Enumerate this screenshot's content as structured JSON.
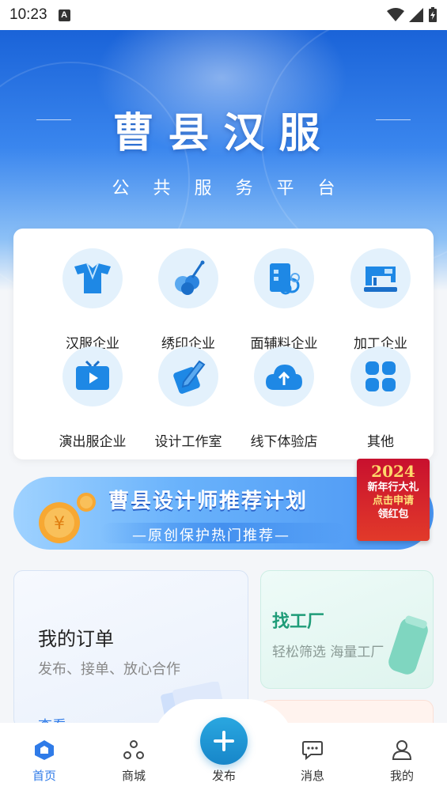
{
  "status_bar": {
    "time": "10:23",
    "indicator": "A"
  },
  "hero": {
    "title": "曹县汉服",
    "subtitle": "公共服务平台"
  },
  "categories": [
    {
      "label": "汉服企业",
      "icon": "hanfu-robe-icon"
    },
    {
      "label": "绣印企业",
      "icon": "embroidery-icon"
    },
    {
      "label": "面辅料企业",
      "icon": "fabric-icon"
    },
    {
      "label": "加工企业",
      "icon": "sewing-machine-icon"
    },
    {
      "label": "演出服企业",
      "icon": "tv-play-icon"
    },
    {
      "label": "设计工作室",
      "icon": "design-pen-icon"
    },
    {
      "label": "线下体验店",
      "icon": "cloud-upload-icon"
    },
    {
      "label": "其他",
      "icon": "grid-icon"
    }
  ],
  "banner": {
    "title": "曹县设计师推荐计划",
    "subtitle": "—原创保护热门推荐—",
    "promo": {
      "year": "2024",
      "line1": "新年行大礼",
      "line2": "点击申请",
      "line3": "领红包"
    }
  },
  "services": {
    "order": {
      "title": "我的订单",
      "desc": "发布、接单、放心合作",
      "link": "查看"
    },
    "factory": {
      "title": "找工厂",
      "desc": "轻松筛选 海量工厂"
    }
  },
  "bottom_nav": {
    "items": [
      {
        "label": "首页",
        "icon": "home-icon",
        "active": true
      },
      {
        "label": "商城",
        "icon": "shop-icon",
        "active": false
      },
      {
        "label": "发布",
        "icon": "plus-icon",
        "active": false
      },
      {
        "label": "消息",
        "icon": "message-icon",
        "active": false
      },
      {
        "label": "我的",
        "icon": "user-icon",
        "active": false
      }
    ]
  },
  "colors": {
    "accent": "#2f7be8",
    "hero_top": "#1a63d8",
    "factory_green": "#1f9c78",
    "fab": "#1786c9"
  }
}
